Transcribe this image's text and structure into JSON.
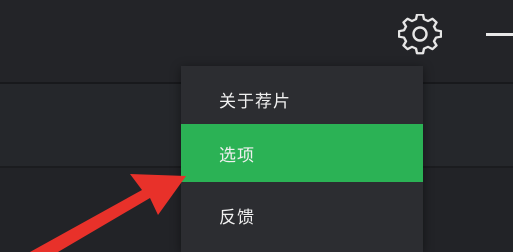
{
  "titlebar": {
    "settings_icon": "gear-icon",
    "minimize_icon": "minimize-icon"
  },
  "menu": {
    "items": [
      {
        "label": "关于荐片",
        "selected": false
      },
      {
        "label": "选项",
        "selected": true
      },
      {
        "label": "反馈",
        "selected": false
      }
    ]
  },
  "annotation": {
    "arrow_icon": "red-arrow-icon",
    "arrow_color": "#e8312a"
  },
  "colors": {
    "highlight": "#2bb255",
    "menu_bg": "#2c2d31",
    "app_bg": "#1f2023"
  }
}
